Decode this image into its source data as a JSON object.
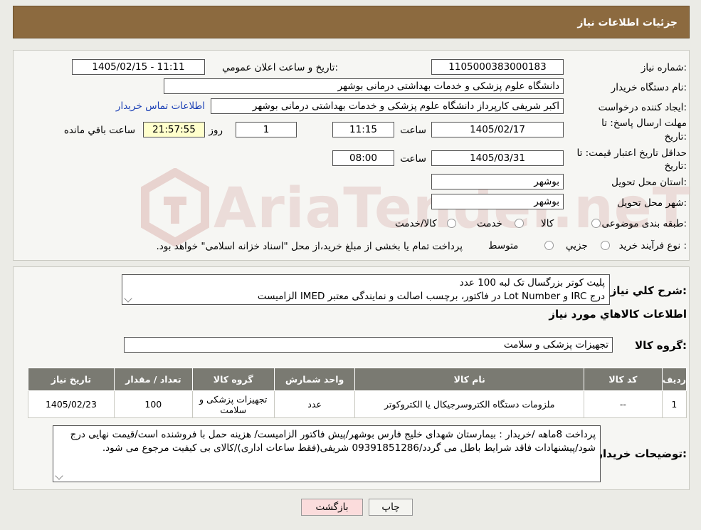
{
  "header": {
    "title": "جزئیات اطلاعات نیاز"
  },
  "form": {
    "need_number_label": "شماره نیاز:",
    "need_number": "1105000383000183",
    "announce_label": "تاریخ و ساعت اعلان عمومي:",
    "announce_value": "1405/02/15 - 11:11",
    "buyer_org_label": "نام دستگاه خریدار:",
    "buyer_org": "دانشگاه علوم پزشکی و خدمات بهداشتی درمانی بوشهر",
    "creator_label": "ایجاد کننده درخواست:",
    "creator": "اکبر شریفی کارپرداز دانشگاه علوم پزشکی و خدمات بهداشتی درمانی بوشهر",
    "contact_link": "اطلاعات تماس خریدار",
    "deadline_label_1": "مهلت ارسال پاسخ: تا",
    "deadline_label_2": "تاریخ:",
    "deadline_date": "1405/02/17",
    "time_label": "ساعت",
    "deadline_time": "11:15",
    "days_value": "1",
    "days_label": "روز و",
    "remaining_time": "21:57:55",
    "remaining_label": "ساعت باقي مانده",
    "validity_label_1": "حداقل تاریخ اعتبار قیمت: تا",
    "validity_label_2": "تاریخ:",
    "validity_date": "1405/03/31",
    "validity_time": "08:00",
    "province_label": "استان محل تحویل:",
    "province": "بوشهر",
    "city_label": "شهر محل تحویل:",
    "city": "بوشهر",
    "category_label": "طبقه بندی موضوعی:",
    "category_options": [
      "کالا",
      "خدمت",
      "کالا/خدمت"
    ],
    "process_label": "نوع فرآیند خرید :",
    "process_options": [
      "جزیي",
      "متوسط"
    ],
    "process_note": "پرداخت تمام یا بخشی از مبلغ خرید،از محل \"اسناد خزانه اسلامی\" خواهد بود."
  },
  "details": {
    "summary_label": "شرح کلي نیاز:",
    "summary_line1": "پلیت کوتر بزرگسال تک لبه 100 عدد",
    "summary_line2": "درج IRC و Lot Number در فاکتور، برچسب اصالت و نمایندگی معتبر IMED الزامیست",
    "goods_info_title": "اطلاعات کالاهاي مورد نیاز",
    "goods_group_label": "گروه کالا:",
    "goods_group": "تجهیزات پزشکی و سلامت",
    "table": {
      "headers": [
        "ردیف",
        "کد کالا",
        "نام کالا",
        "واحد شمارش",
        "گروه کالا",
        "تعداد / مقدار",
        "تاریخ نیاز"
      ],
      "rows": [
        [
          "1",
          "--",
          "ملزومات دستگاه الکتروسرجیکال یا الکتروکوتر",
          "عدد",
          "تجهیزات پزشکی و سلامت",
          "100",
          "1405/02/23"
        ]
      ]
    },
    "buyer_notes_label": "توضیحات خریدار:",
    "buyer_notes": "پرداخت 8ماهه /خریدار : بیمارستان شهدای خلیج فارس بوشهر/پیش فاکتور الزامیست/ هزینه حمل با فروشنده است/قیمت نهایی درج شود/پیشنهادات فاقد شرایط باطل می گردد/09391851286 شریفی(فقط ساعات اداری)/کالای بی کیفیت مرجوع می شود."
  },
  "buttons": {
    "print": "چاپ",
    "back": "بازگشت"
  },
  "watermark": "AriaTender.neT",
  "colors": {
    "header_bg": "#8c6a3f",
    "table_header_bg": "#7a7a72",
    "link": "#1a3fb5",
    "back_button_bg": "#fbdcdc"
  }
}
